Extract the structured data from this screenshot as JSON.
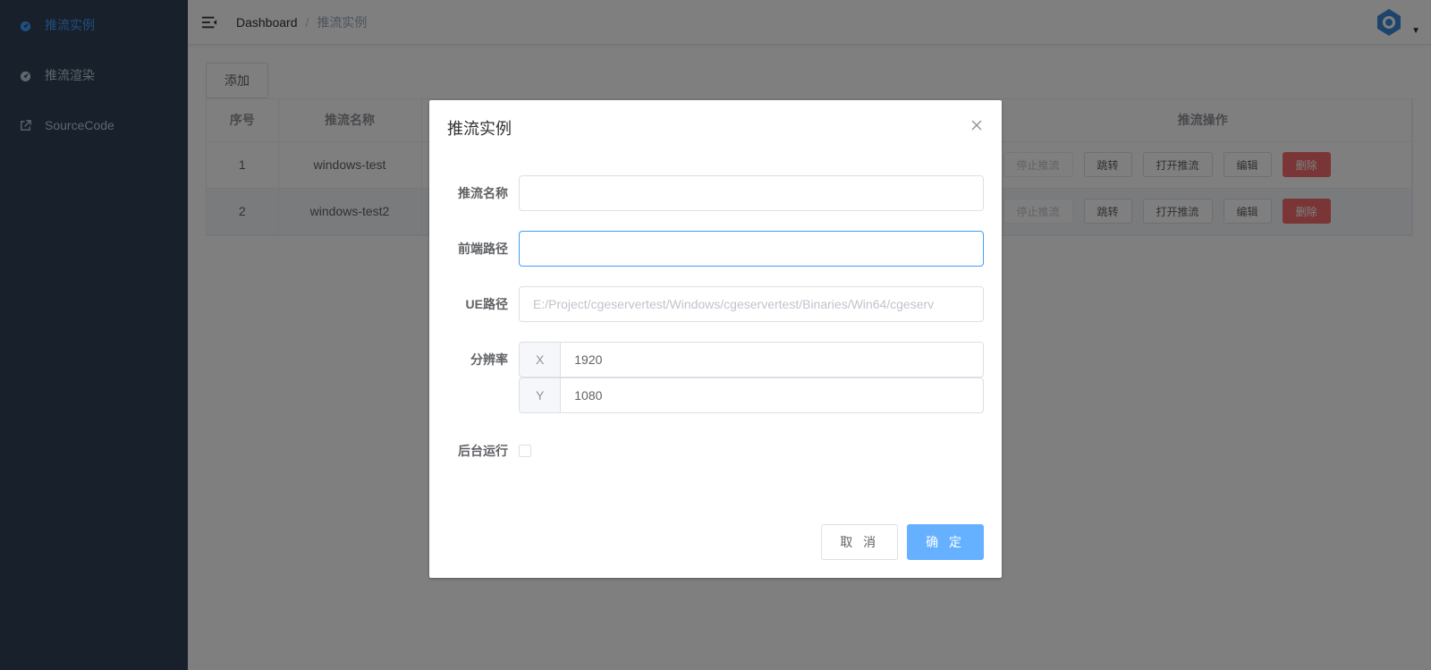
{
  "sidebar": {
    "items": [
      {
        "label": "推流实例",
        "icon": "dashboard-icon"
      },
      {
        "label": "推流渲染",
        "icon": "dashboard-icon"
      },
      {
        "label": "SourceCode",
        "icon": "external-link-icon"
      }
    ]
  },
  "navbar": {
    "breadcrumb": [
      "Dashboard",
      "/",
      "推流实例"
    ],
    "caret": "▼"
  },
  "toolbar": {
    "add_label": "添加"
  },
  "table": {
    "headers": [
      "序号",
      "推流名称",
      "推流操作"
    ],
    "rows": [
      {
        "index": "1",
        "name": "windows-test"
      },
      {
        "index": "2",
        "name": "windows-test2"
      }
    ],
    "actions": {
      "stop": "停止推流",
      "jump": "跳转",
      "open": "打开推流",
      "edit": "编辑",
      "delete": "删除"
    }
  },
  "dialog": {
    "title": "推流实例",
    "fields": {
      "name_label": "推流名称",
      "name_value": "",
      "frontend_label": "前端路径",
      "frontend_value": "",
      "ue_label": "UE路径",
      "ue_placeholder": "E:/Project/cgeservertest/Windows/cgeservertest/Binaries/Win64/cgeserv",
      "resolution_label": "分辨率",
      "x_label": "X",
      "x_value": "1920",
      "y_label": "Y",
      "y_value": "1080",
      "background_label": "后台运行"
    },
    "cancel_label": "取 消",
    "confirm_label": "确 定"
  },
  "colors": {
    "sidebar_bg": "#304156",
    "accent": "#409eff",
    "danger": "#f56c6c"
  }
}
